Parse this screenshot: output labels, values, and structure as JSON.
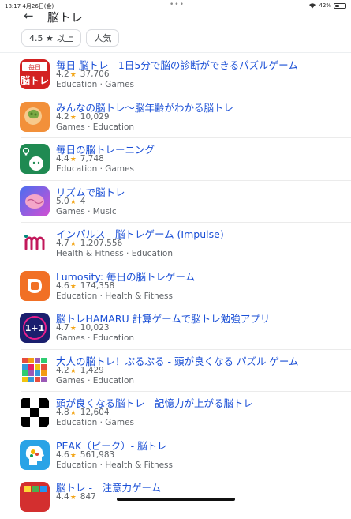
{
  "status": {
    "time": "18:17",
    "date": "4月26日(金)",
    "battery": "42%",
    "battery_level": 0.42
  },
  "header": {
    "back_icon": "arrow-left-icon",
    "query": "脳トレ"
  },
  "filters": [
    {
      "label": "4.5 ★ 以上"
    },
    {
      "label": "人気"
    }
  ],
  "apps": [
    {
      "title": "毎日 脳トレ - 1日5分で脳の診断ができるパズルゲーム",
      "rating": "4.2",
      "reviews": "37,706",
      "categories": "Education · Games",
      "icon": "maiinchi-notore-icon"
    },
    {
      "title": "みんなの脳トレ〜脳年齢がわかる脳トレ",
      "rating": "4.2",
      "reviews": "10,029",
      "categories": "Games · Education",
      "icon": "brain-head-icon"
    },
    {
      "title": "毎日の脳トレーニング",
      "rating": "4.4",
      "reviews": "7,748",
      "categories": "Education · Games",
      "icon": "smiley-bulb-icon"
    },
    {
      "title": "リズムで脳トレ",
      "rating": "5.0",
      "reviews": "4",
      "categories": "Games · Music",
      "icon": "rhythm-brain-icon"
    },
    {
      "title": "インパルス - 脳トレゲーム (Impulse)",
      "rating": "4.7",
      "reviews": "1,207,556",
      "categories": "Health & Fitness · Education",
      "icon": "impulse-logo-icon"
    },
    {
      "title": "Lumosity: 毎日の脳トレゲーム",
      "rating": "4.6",
      "reviews": "174,358",
      "categories": "Education · Health & Fitness",
      "icon": "lumosity-icon"
    },
    {
      "title": "脳トレHAMARU 計算ゲームで脳トレ勉強アプリ",
      "rating": "4.7",
      "reviews": "10,023",
      "categories": "Games · Education",
      "icon": "hamaru-one-plus-one-icon"
    },
    {
      "title": "大人の脳トレ！ぷるぷる - 頭が良くなる パズル ゲーム",
      "rating": "4.2",
      "reviews": "1,429",
      "categories": "Games · Education",
      "icon": "puzzle-grid-icon"
    },
    {
      "title": "頭が良くなる脳トレ - 記憶力が上がる脳トレ",
      "rating": "4.8",
      "reviews": "12,604",
      "categories": "Education · Games",
      "icon": "checker-pattern-icon"
    },
    {
      "title": "PEAK（ピーク）- 脳トレ",
      "rating": "4.6",
      "reviews": "561,983",
      "categories": "Education · Health & Fitness",
      "icon": "peak-head-icon"
    },
    {
      "title": "脳トレ -　注意力ゲーム",
      "rating": "4.4",
      "reviews": "847",
      "categories": "",
      "icon": "attention-game-icon"
    }
  ]
}
